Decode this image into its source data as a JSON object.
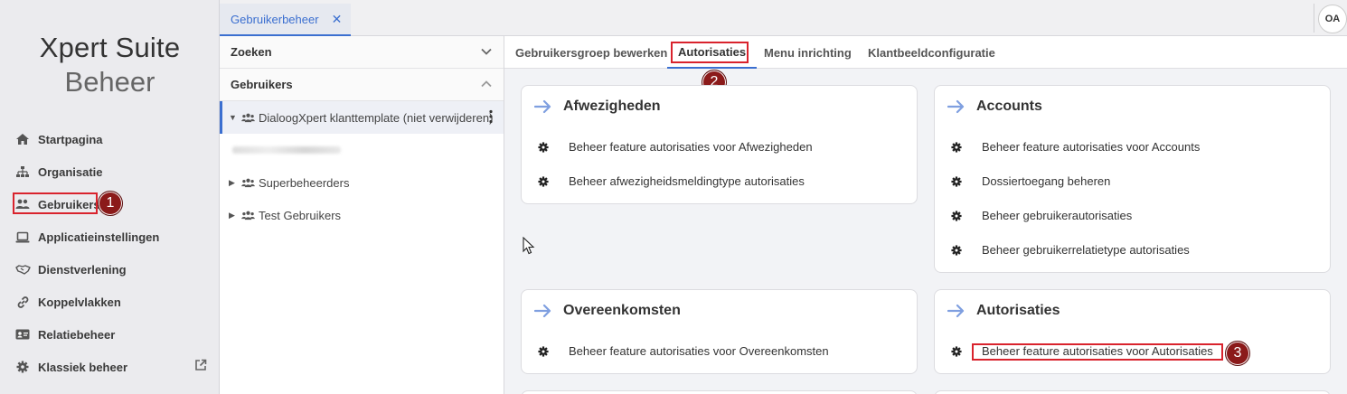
{
  "sidebar": {
    "logo_line1": "Xpert Suite",
    "logo_line2": "Beheer",
    "items": [
      {
        "label": "Startpagina",
        "icon": "home-icon"
      },
      {
        "label": "Organisatie",
        "icon": "sitemap-icon"
      },
      {
        "label": "Gebruikers",
        "icon": "users-icon"
      },
      {
        "label": "Applicatieinstellingen",
        "icon": "laptop-icon"
      },
      {
        "label": "Dienstverlening",
        "icon": "handshake-icon"
      },
      {
        "label": "Koppelvlakken",
        "icon": "link-icon"
      },
      {
        "label": "Relatiebeheer",
        "icon": "id-card-icon"
      },
      {
        "label": "Klassiek beheer",
        "icon": "gear-icon"
      }
    ]
  },
  "topbar": {
    "tab_label": "Gebruikerbeheer",
    "close_glyph": "✕",
    "avatar": "OA"
  },
  "tree": {
    "search_label": "Zoeken",
    "users_label": "Gebruikers",
    "nodes": [
      {
        "label": "DialoogXpert klanttemplate (niet verwijderen)"
      },
      {
        "label": ""
      },
      {
        "label": "Superbeheerders"
      },
      {
        "label": "Test Gebruikers"
      }
    ]
  },
  "content": {
    "subtabs": [
      "Gebruikersgroep bewerken",
      "Autorisaties",
      "Menu inrichting",
      "Klantbeeldconfiguratie"
    ],
    "cards": [
      {
        "title": "Afwezigheden",
        "items": [
          "Beheer feature autorisaties voor Afwezigheden",
          "Beheer afwezigheidsmeldingtype autorisaties"
        ]
      },
      {
        "title": "Accounts",
        "items": [
          "Beheer feature autorisaties voor Accounts",
          "Dossiertoegang beheren",
          "Beheer gebruikerautorisaties",
          "Beheer gebruikerrelatietype autorisaties"
        ]
      },
      {
        "title": "Overeenkomsten",
        "items": [
          "Beheer feature autorisaties voor Overeenkomsten"
        ]
      },
      {
        "title": "Autorisaties",
        "items": [
          "Beheer feature autorisaties voor Autorisaties"
        ]
      }
    ]
  },
  "annotations": {
    "m1": "1",
    "m2": "2",
    "m3": "3"
  },
  "colors": {
    "accent": "#3b6fd0",
    "highlight": "#d9232d",
    "marker": "#8b1a1a"
  }
}
